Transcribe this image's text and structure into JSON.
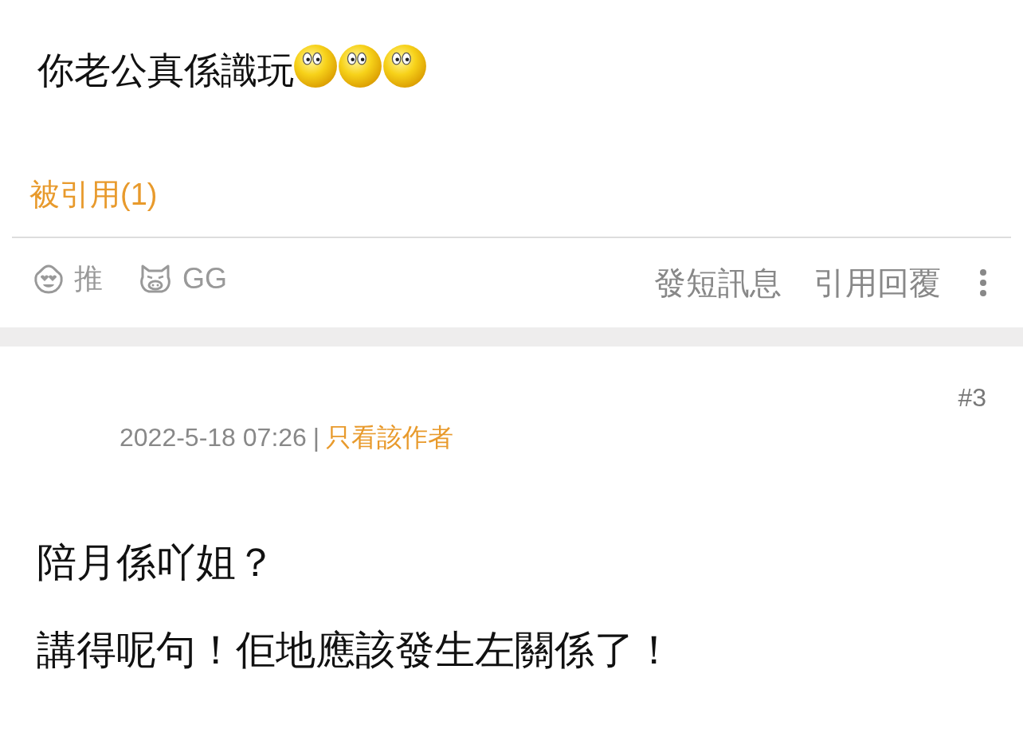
{
  "post": {
    "text": "你老公真係識玩",
    "emoticons": [
      {
        "kind": "emoticon"
      },
      {
        "kind": "emoticon"
      },
      {
        "kind": "emoticon"
      }
    ],
    "quoted_link": "被引用(1)",
    "actions_left": [
      {
        "kind": "face",
        "label": "推"
      },
      {
        "kind": "pig",
        "label": "GG"
      }
    ],
    "actions_right": [
      "發短訊息",
      "引用回覆"
    ]
  },
  "next_post": {
    "floor": "#3",
    "date": "2022-5-18 07:26",
    "separator": "|",
    "author_filter": "只看該作者",
    "lines": [
      "陪月係吖姐？",
      "講得呢句！佢地應該發生左關係了！"
    ]
  }
}
